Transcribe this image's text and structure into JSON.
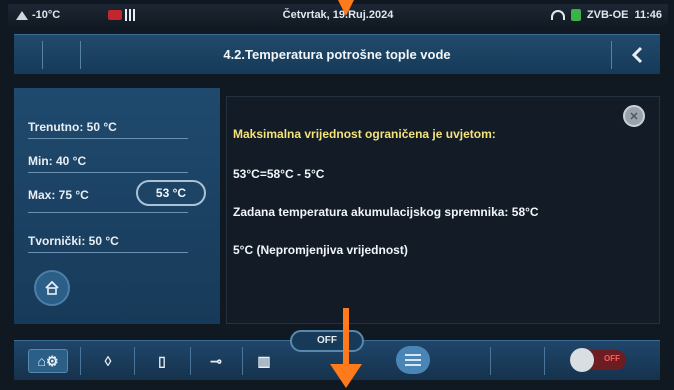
{
  "status_bar": {
    "outdoor_temp": "-10°C",
    "date": "Četvrtak, 19.Ruj.2024",
    "device_name": "ZVB-OE",
    "time": "11:46"
  },
  "header": {
    "title": "4.2.Temperatura potrošne tople vode"
  },
  "left_panel": {
    "current": "Trenutno: 50 °C",
    "min": "Min: 40 °C",
    "max": "Max: 75 °C",
    "factory": "Tvornički: 50 °C",
    "set_value": "53 °C"
  },
  "info_panel": {
    "heading": "Maksimalna vrijednost ograničena je uvjetom:",
    "formula": "53°C=58°C - 5°C",
    "line1": "Zadana temperatura akumulacijskog spremnika: 58°C",
    "line2": "5°C (Nepromjenjiva vrijednost)"
  },
  "bottom_bar": {
    "off_label": "OFF",
    "toggle_label": "OFF"
  },
  "colors": {
    "accent_panel": "#1f4a6e",
    "heading_text": "#f4e27a",
    "annotation_arrow": "#ff7a1a",
    "toggle_off": "#6b1d22"
  }
}
